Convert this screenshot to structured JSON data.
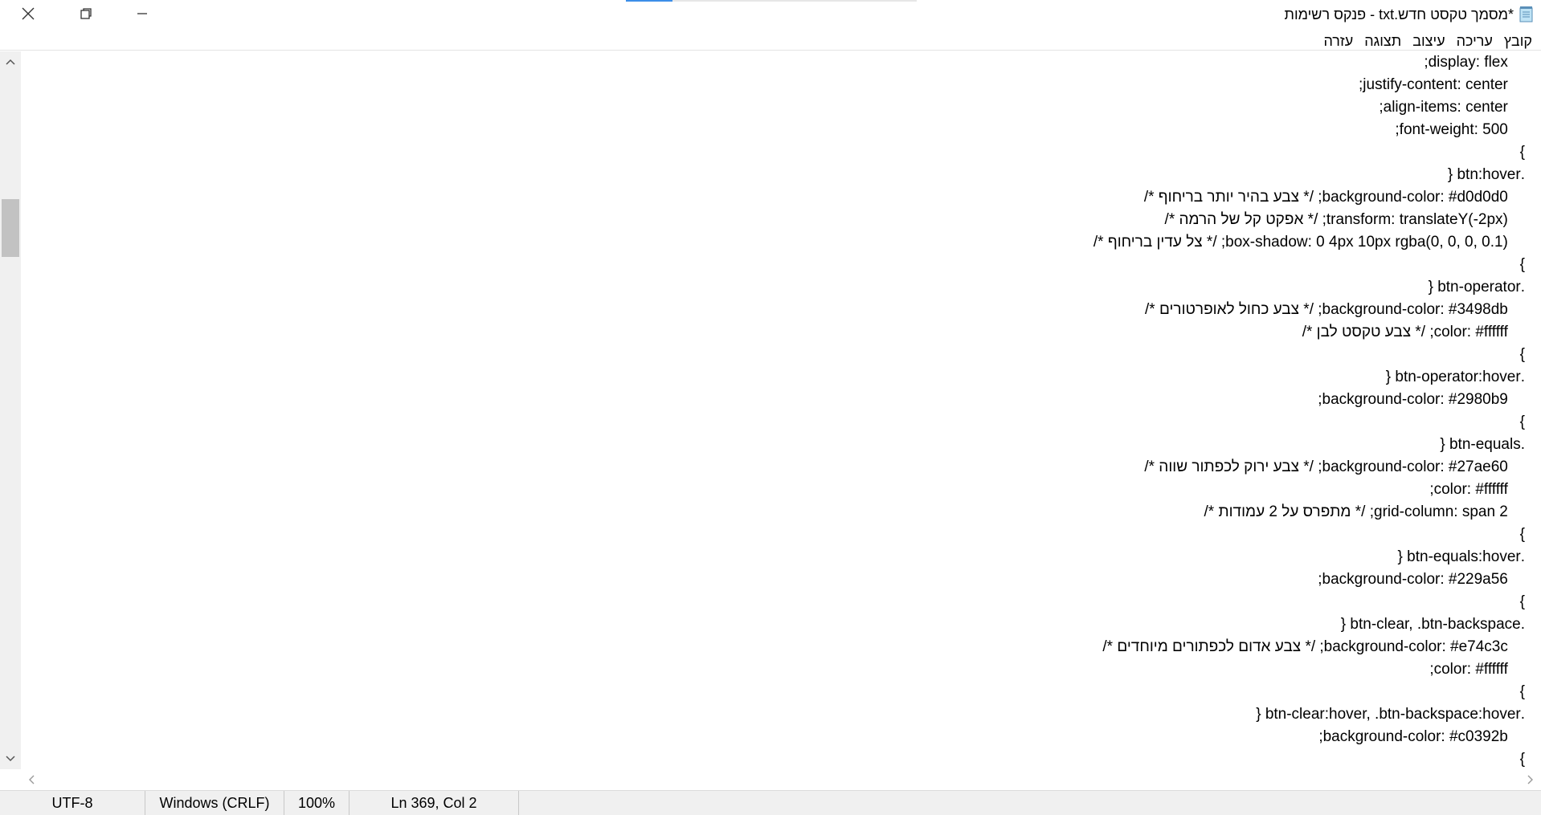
{
  "window": {
    "title": "*מסמך טקסט חדש.txt - פנקס רשימות",
    "controls": {
      "close": "×",
      "restore": "⧉",
      "minimize": "—"
    },
    "load_progress": 0.16
  },
  "menu": [
    "קובץ",
    "עריכה",
    "עיצוב",
    "תצוגה",
    "עזרה"
  ],
  "editor": {
    "lines": [
      "    display: flex;",
      "    justify-content: center;",
      "    align-items: center;",
      "    font-weight: 500;",
      "}",
      ".btn:hover {",
      "    background-color: #d0d0d0; /* צבע בהיר יותר בריחוף */",
      "    transform: translateY(-2px); /* אפקט קל של הרמה */",
      "    box-shadow: 0 4px 10px rgba(0, 0, 0, 0.1); /* צל עדין בריחוף */",
      "}",
      ".btn-operator {",
      "    background-color: #3498db; /* צבע כחול לאופרטורים */",
      "    color: #ffffff; /* צבע טקסט לבן */",
      "}",
      ".btn-operator:hover {",
      "    background-color: #2980b9;",
      "}",
      ".btn-equals {",
      "    background-color: #27ae60; /* צבע ירוק לכפתור שווה */",
      "    color: #ffffff;",
      "    grid-column: span 2; /* מתפרס על 2 עמודות */",
      "}",
      ".btn-equals:hover {",
      "    background-color: #229a56;",
      "}",
      ".btn-clear, .btn-backspace {",
      "    background-color: #e74c3c; /* צבע אדום לכפתורים מיוחדים */",
      "    color: #ffffff;",
      "}",
      ".btn-clear:hover, .btn-backspace:hover {",
      "    background-color: #c0392b;",
      "}"
    ]
  },
  "status": {
    "encoding": "UTF-8",
    "line_ending": "Windows (CRLF)",
    "zoom": "100%",
    "position": "Ln 369, Col 2"
  },
  "scrollbars": {
    "vertical": {
      "up": "˄",
      "down": "˅"
    },
    "horizontal": {
      "left": "‹",
      "right": "›"
    }
  }
}
